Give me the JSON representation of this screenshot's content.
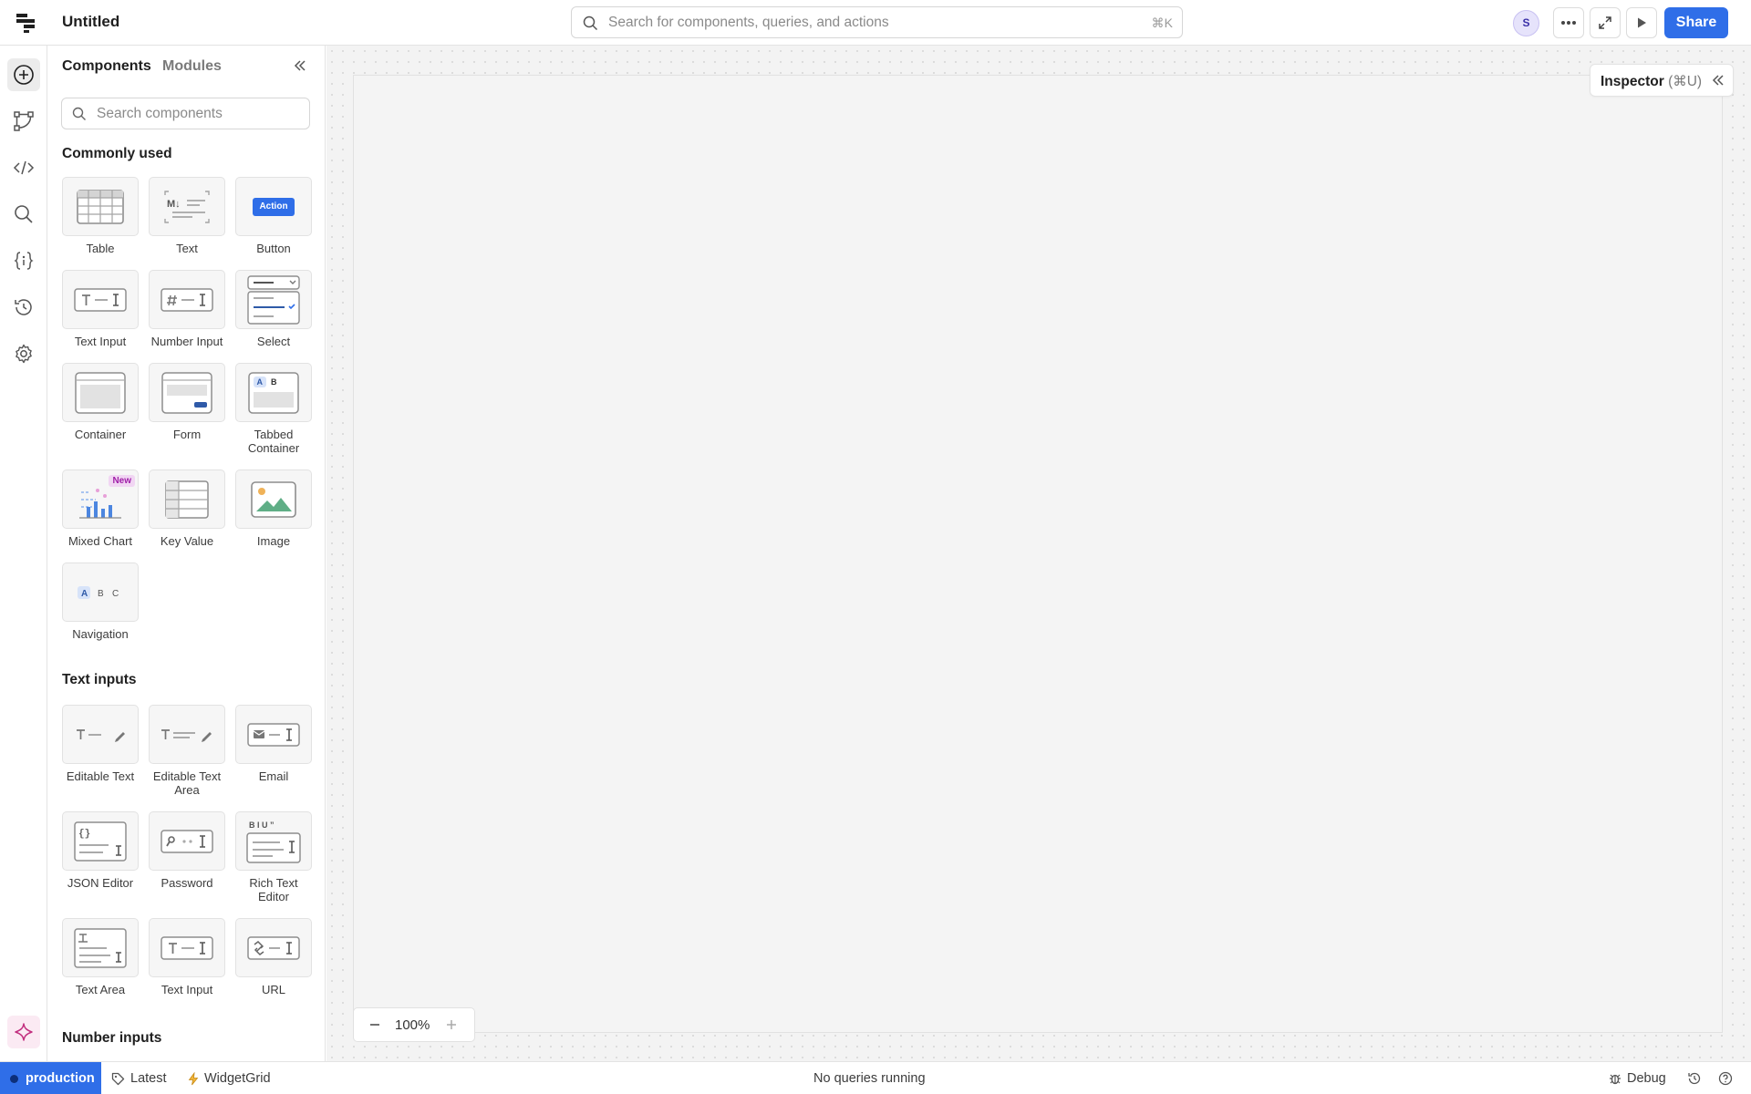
{
  "app": {
    "title": "Untitled"
  },
  "topbar": {
    "search_placeholder": "Search for components, queries, and actions",
    "search_shortcut": "⌘K",
    "avatar_initial": "S",
    "share_label": "Share",
    "accent_color": "#2f6ee8"
  },
  "rail": {
    "items": [
      "add-component-icon",
      "workflow-icon",
      "code-icon",
      "search-icon",
      "state-icon",
      "history-icon",
      "settings-icon"
    ],
    "ai_icon": "sparkle-icon"
  },
  "panel": {
    "tabs": [
      "Components",
      "Modules"
    ],
    "search_placeholder": "Search components",
    "sections": [
      {
        "title": "Commonly used",
        "items": [
          "Table",
          "Text",
          "Button",
          "Text Input",
          "Number Input",
          "Select",
          "Container",
          "Form",
          "Tabbed Container",
          "Mixed Chart",
          "Key Value",
          "Image",
          "Navigation"
        ]
      },
      {
        "title": "Text inputs",
        "items": [
          "Editable Text",
          "Editable Text Area",
          "Email",
          "JSON Editor",
          "Password",
          "Rich Text Editor",
          "Text Area",
          "Text Input",
          "URL"
        ]
      },
      {
        "title": "Number inputs",
        "items": []
      }
    ],
    "new_badge": "New",
    "button_preview_label": "Action",
    "markdown_preview": "M↓",
    "tab_preview": [
      "A",
      "B"
    ],
    "nav_preview": [
      "A",
      "B",
      "C"
    ],
    "rte_preview": "B I U ”"
  },
  "canvas": {
    "inspector_label": "Inspector",
    "inspector_shortcut": "(⌘U)",
    "zoom": "100%"
  },
  "statusbar": {
    "environment": "production",
    "version": "Latest",
    "grid": "WidgetGrid",
    "queries_status": "No queries running",
    "debug_label": "Debug"
  }
}
